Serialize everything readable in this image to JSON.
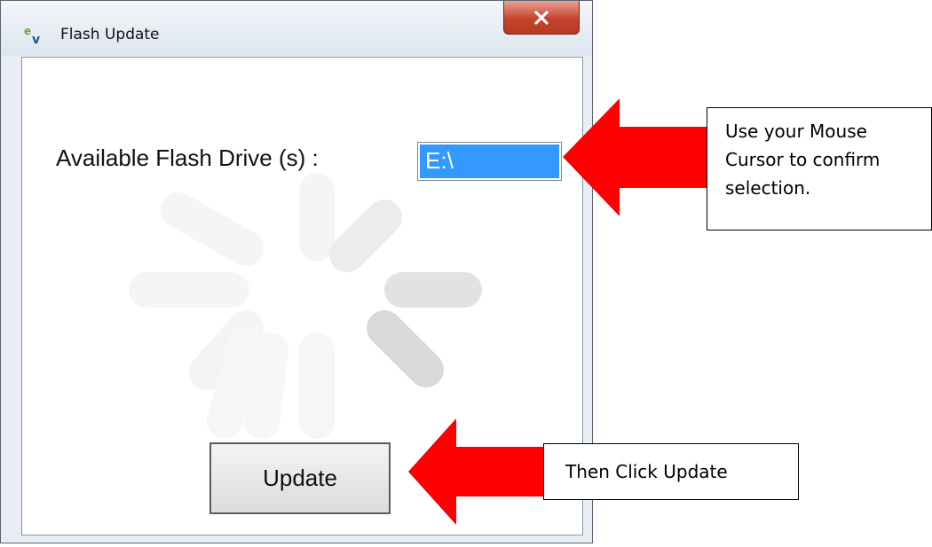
{
  "window": {
    "title": "Flash Update",
    "icon": "ev-app-icon",
    "close_icon": "close-icon"
  },
  "form": {
    "drive_label": "Available Flash Drive (s) :",
    "drives": [
      "E:\\"
    ],
    "selected_drive": "E:\\",
    "update_button": "Update"
  },
  "annotations": {
    "note_select": "Use your Mouse Cursor to confirm selection.",
    "note_update": "Then Click Update",
    "arrow_color": "#ff0000"
  },
  "colors": {
    "selection": "#3399ff",
    "close_button": "#c4442c"
  }
}
